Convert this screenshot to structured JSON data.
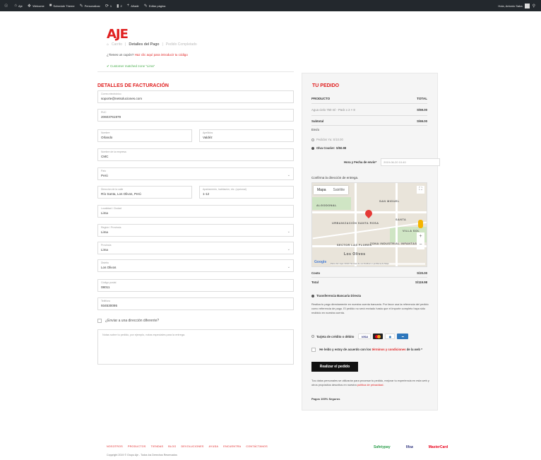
{
  "adminbar": {
    "site": "Aje",
    "customize": "Personalizar",
    "comments_count": "2",
    "updates_count": "1",
    "new": "Añadir",
    "edit_page": "Editar página",
    "woo": "Welcome",
    "theme": "Schedule Theme",
    "greeting": "Hola, Antonio Saba"
  },
  "logo": "AJE",
  "breadcrumb": {
    "cart": "Carrito",
    "payment": "Detalles del Pago",
    "done": "Pedido Completado"
  },
  "coupon": {
    "question": "¿Tienes un cupón?",
    "link": "Haz clic aquí para introducir tu código"
  },
  "matched": "Customer matched zone \"Lima\"",
  "billing": {
    "title": "Detalles de facturación",
    "fields": {
      "email": {
        "label": "Correo electrónico",
        "value": "soporte@netsoluciones.com"
      },
      "ruc": {
        "label": "RUC",
        "value": "20603761979"
      },
      "first_name": {
        "label": "Nombre",
        "value": "Orlando"
      },
      "last_name": {
        "label": "Apellidos",
        "value": "Valdéz"
      },
      "company": {
        "label": "Nombre de la empresa",
        "value": "CMC"
      },
      "country": {
        "label": "País",
        "value": "Perú"
      },
      "address": {
        "label": "Dirección de la calle",
        "value": "Río Santa, Los Olivos, Perú"
      },
      "apartment": {
        "label": "Apartamento, habitación, etc. (opcional)",
        "value": "1-12"
      },
      "city": {
        "label": "Localidad / Ciudad",
        "value": "Lima"
      },
      "region": {
        "label": "Región / Provincia",
        "value": "Lima"
      },
      "province": {
        "label": "Provincia",
        "value": "Lima"
      },
      "district": {
        "label": "Distrito",
        "value": "Los Olivos"
      },
      "postcode": {
        "label": "Código postal",
        "value": "08011"
      },
      "phone": {
        "label": "Teléfono",
        "value": "934530095"
      }
    },
    "ship_other": "¿Enviar a una dirección diferente?",
    "notes_placeholder": "Notas sobre tu pedido, por ejemplo, notas especiales para la entrega."
  },
  "order": {
    "title": "TU PEDIDO",
    "col_product": "PRODUCTO",
    "col_total": "TOTAL",
    "item_name": "Agua cielo 750 ml - Pack x 2 × 8",
    "item_total": "S/69.00",
    "subtotal_label": "Subtotal",
    "subtotal": "S/69.00",
    "shipping_label": "Envío",
    "ship_options": [
      "Pedidos Ya: S/10.00",
      "Olva Courier: S/50.98"
    ],
    "datetime_label": "Hora y Fecha de envío*",
    "datetime_value": "2019-06-20 10:40",
    "map_caption": "Confirma la dirección de entrega.",
    "map_tab_map": "Mapa",
    "map_tab_sat": "Satélite",
    "costo_label": "Costo",
    "costo": "S/20.00",
    "total_label": "Total",
    "total": "S/119.98",
    "bank_transfer": "Transferencia Bancaria Directa",
    "bank_desc": "Realiza tu pago directamente en nuestra cuenta bancaria. Por favor usa la referencia del pedido como referencia de pago. El pedido no será enviado hasta que el importe completo haya sido recibido en nuestra cuenta.",
    "card_option": "Tarjeta de crédito o débito",
    "card_logos": [
      "VISA",
      "MC",
      "AMEX",
      "DINERS"
    ],
    "terms_prefix": "He leído y estoy de acuerdo con los",
    "terms_link": "términos y condiciones",
    "terms_suffix": "de la web *",
    "place_order": "Realizar el pedido",
    "privacy_text": "Tus datos personales se utilizarán para procesar tu pedido, mejorar tu experiencia en esta web y otros propósitos descritos en nuestra",
    "privacy_link": "política de privacidad.",
    "secure": "Pagos 100% Seguros"
  },
  "map_labels": [
    "ALGODONAL",
    "SAN MIGUEL",
    "SANTA",
    "URBANIZACIÓN SANTA ROSA",
    "VILLA SOL",
    "SECTOR LAS FLORES",
    "Los Olivos",
    "ZONA INDUSTRIAL INFANTAS"
  ],
  "map_attribution": "Datos del mapa ©2019  Términos de uso  Notificar un problema de Maps",
  "footer": {
    "links": [
      "NOSOTROS",
      "PRODUCTOS",
      "TIENDAS",
      "BLOG",
      "DEVOLUCIONES",
      "AYUDA",
      "ENCUENTRA",
      "CONTÁCTANOS"
    ],
    "copyright": "Copyright 2019 © Grupo Aje - Todos los Derechos Reservados",
    "logos": [
      "Safetypay",
      "Visa",
      "MasterCard"
    ]
  },
  "colors": {
    "accent": "#e02020",
    "adminbar": "#23282d"
  }
}
